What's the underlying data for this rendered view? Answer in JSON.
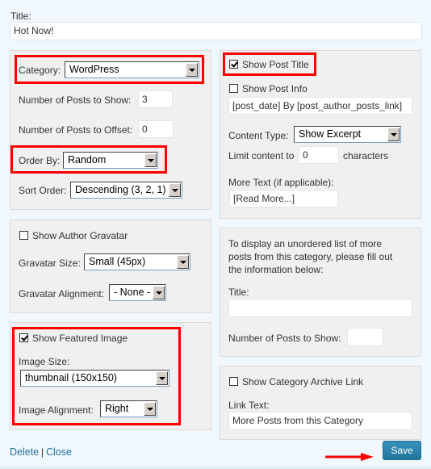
{
  "title_field": {
    "label": "Title:",
    "value": "Hot Now!"
  },
  "left": {
    "category": {
      "label": "Category:",
      "value": "WordPress"
    },
    "num_posts": {
      "label": "Number of Posts to Show:",
      "value": "3"
    },
    "offset": {
      "label": "Number of Posts to Offset:",
      "value": "0"
    },
    "order_by": {
      "label": "Order By:",
      "value": "Random"
    },
    "sort_order": {
      "label": "Sort Order:",
      "value": "Descending (3, 2, 1)"
    },
    "gravatar": {
      "show_label": "Show Author Gravatar",
      "show_checked": false,
      "size_label": "Gravatar Size:",
      "size_value": "Small (45px)",
      "align_label": "Gravatar Alignment:",
      "align_value": "- None -"
    },
    "featured": {
      "show_label": "Show Featured Image",
      "show_checked": true,
      "size_label": "Image Size:",
      "size_value": "thumbnail (150x150)",
      "align_label": "Image Alignment:",
      "align_value": "Right"
    }
  },
  "right": {
    "post_title": {
      "label": "Show Post Title",
      "checked": true
    },
    "post_info": {
      "label": "Show Post Info",
      "checked": false,
      "value": "[post_date] By [post_author_posts_link]"
    },
    "content_type": {
      "label": "Content Type:",
      "value": "Show Excerpt"
    },
    "limit": {
      "label": "Limit content to",
      "value": "0",
      "suffix": "characters"
    },
    "more_text": {
      "label": "More Text (if applicable):",
      "value": "[Read More...]"
    },
    "extra_list": {
      "description": [
        "To display an unordered list of more",
        "posts from this category, please fill out",
        "the information below:"
      ],
      "title_label": "Title:",
      "title_value": "",
      "num_label": "Number of Posts to Show:",
      "num_value": ""
    },
    "archive": {
      "show_label": "Show Category Archive Link",
      "show_checked": false,
      "link_label": "Link Text:",
      "link_value": "More Posts from this Category"
    }
  },
  "footer": {
    "delete": "Delete",
    "separator": "|",
    "close": "Close",
    "save": "Save"
  },
  "colors": {
    "highlight": "#ff0000",
    "link": "#21759b",
    "save_button": "#21759b"
  }
}
